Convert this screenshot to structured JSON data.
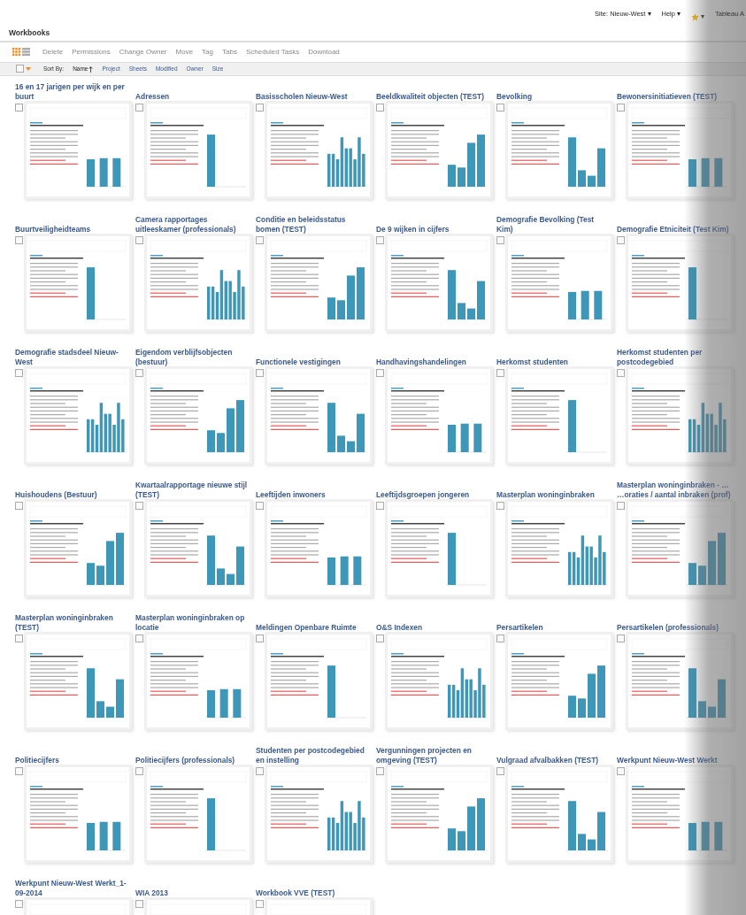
{
  "top_bar": {
    "site": "Site: Nieuw-West ▾",
    "help": "Help ▾",
    "favorites": "▾",
    "user": "Tableau A"
  },
  "page_title": "Workbooks",
  "view_modes": [
    {
      "kind": "grid",
      "selected": true
    },
    {
      "kind": "list",
      "selected": false
    }
  ],
  "actions": [
    {
      "label": "Delete",
      "disabled": true
    },
    {
      "label": "Permissions",
      "disabled": true
    },
    {
      "label": "Change Owner",
      "disabled": true
    },
    {
      "label": "Move",
      "disabled": true
    },
    {
      "label": "Tag",
      "disabled": true
    },
    {
      "label": "Tabs",
      "disabled": true
    },
    {
      "label": "Scheduled Tasks",
      "disabled": true
    },
    {
      "label": "Download",
      "disabled": true
    }
  ],
  "sort": {
    "label": "Sort By:",
    "options": [
      {
        "label": "Name",
        "selected": true
      },
      {
        "label": "Project",
        "selected": false
      },
      {
        "label": "Sheets",
        "selected": false
      },
      {
        "label": "Modified",
        "selected": false
      },
      {
        "label": "Owner",
        "selected": false
      },
      {
        "label": "Size",
        "selected": false
      }
    ],
    "select_all_checked": false
  },
  "workbooks": [
    {
      "title": "16 en 17 jarigen per wijk en per buurt",
      "checked": false
    },
    {
      "title": "Adressen",
      "checked": false
    },
    {
      "title": "Basisscholen Nieuw-West",
      "checked": false
    },
    {
      "title": "Beeldkwaliteit objecten (TEST)",
      "checked": false
    },
    {
      "title": "Bevolking",
      "checked": false
    },
    {
      "title": "Bewonersinitiatieven (TEST)",
      "checked": false
    },
    {
      "title": "Buurtveiligheidteams",
      "checked": false
    },
    {
      "title": "Camera rapportages uitleeskamer (professionals)",
      "checked": false
    },
    {
      "title": "Conditie en beleidsstatus bomen (TEST)",
      "checked": false
    },
    {
      "title": "De 9 wijken in cijfers",
      "checked": false
    },
    {
      "title": "Demografie Bevolking (Test Kim)",
      "checked": false
    },
    {
      "title": "Demografie Etniciteit (Test Kim)",
      "checked": false
    },
    {
      "title": "Demografie stadsdeel Nieuw-West",
      "checked": false
    },
    {
      "title": "Eigendom verblijfsobjecten (bestuur)",
      "checked": false
    },
    {
      "title": "Functionele vestigingen",
      "checked": false
    },
    {
      "title": "Handhavingshandelingen",
      "checked": false
    },
    {
      "title": "Herkomst studenten",
      "checked": false
    },
    {
      "title": "Herkomst studenten per postcodegebied",
      "checked": false
    },
    {
      "title": "Huishoudens (Bestuur)",
      "checked": false
    },
    {
      "title": "Kwartaalrapportage nieuwe stijl (TEST)",
      "checked": false
    },
    {
      "title": "Leeftijden inwoners",
      "checked": false
    },
    {
      "title": "Leeftijdsgroepen jongeren",
      "checked": false
    },
    {
      "title": "Masterplan woninginbraken",
      "checked": false
    },
    {
      "title": "Masterplan woninginbraken - … …oraties / aantal inbraken (prof)",
      "checked": false
    },
    {
      "title": "Masterplan woninginbraken (TEST)",
      "checked": false
    },
    {
      "title": "Masterplan woninginbraken op locatie",
      "checked": false
    },
    {
      "title": "Meldingen Openbare Ruimte",
      "checked": false
    },
    {
      "title": "O&S Indexen",
      "checked": false
    },
    {
      "title": "Persartikelen",
      "checked": false
    },
    {
      "title": "Persartikelen (professionals)",
      "checked": false
    },
    {
      "title": "Politiecijfers",
      "checked": false
    },
    {
      "title": "Politiecijfers (professionals)",
      "checked": false
    },
    {
      "title": "Studenten per postcodegebied en instelling",
      "checked": false
    },
    {
      "title": "Vergunningen projecten en omgeving (TEST)",
      "checked": false
    },
    {
      "title": "Vulgraad afvalbakken (TEST)",
      "checked": false
    },
    {
      "title": "Werkpunt Nieuw-West Werkt",
      "checked": false
    },
    {
      "title": "Werkpunt Nieuw-West Werkt_1-09-2014",
      "checked": false
    },
    {
      "title": "WIA 2013",
      "checked": false
    },
    {
      "title": "Workbook VVE (TEST)",
      "checked": false
    }
  ]
}
